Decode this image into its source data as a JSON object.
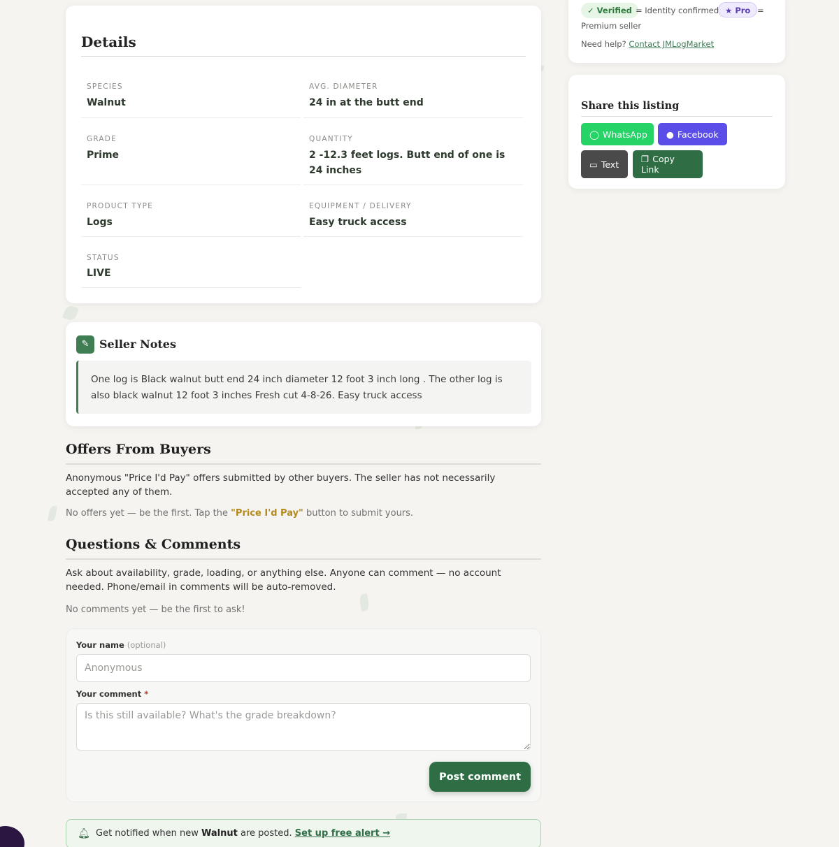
{
  "details": {
    "title": "Details",
    "fields": [
      {
        "label": "SPECIES",
        "value": "Walnut"
      },
      {
        "label": "AVG. DIAMETER",
        "value": "24 in at the butt end"
      },
      {
        "label": "GRADE",
        "value": "Prime"
      },
      {
        "label": "QUANTITY",
        "value": "2 -12.3 feet logs. Butt end of one is 24 inches"
      },
      {
        "label": "PRODUCT TYPE",
        "value": "Logs"
      },
      {
        "label": "EQUIPMENT / DELIVERY",
        "value": "Easy truck access"
      },
      {
        "label": "STATUS",
        "value": "LIVE"
      }
    ]
  },
  "seller_notes": {
    "title": "Seller Notes",
    "text": "One log is Black walnut  butt end 24 inch diameter 12 foot 3 inch long . The other log is also black walnut 12 foot 3 inches Fresh cut 4-8-26. Easy truck access"
  },
  "offers": {
    "title": "Offers From Buyers",
    "description": "Anonymous \"Price I'd Pay\" offers submitted by other buyers. The seller has not necessarily accepted any of them.",
    "empty_prefix": "No offers yet — be the first. Tap the ",
    "empty_highlight": "\"Price I'd Pay\"",
    "empty_suffix": " button to submit yours."
  },
  "comments": {
    "title": "Questions & Comments",
    "description": "Ask about availability, grade, loading, or anything else. Anyone can comment — no account needed. Phone/email in comments will be auto-removed.",
    "empty": "No comments yet — be the first to ask!",
    "form": {
      "name_label": "Your name",
      "name_optional": "(optional)",
      "name_placeholder": "Anonymous",
      "comment_label": "Your comment",
      "comment_required": "*",
      "comment_placeholder": "Is this still available? What's the grade breakdown?",
      "submit_label": "Post comment"
    }
  },
  "alert": {
    "prefix": "Get notified when new ",
    "species": "Walnut",
    "middle": " are posted. ",
    "link": "Set up free alert →"
  },
  "legend": {
    "verified_badge": "Verified",
    "verified_desc": "= Identity confirmed",
    "pro_badge": "Pro",
    "pro_desc_eq": "=",
    "pro_desc": "Premium seller",
    "help_prefix": "Need help?",
    "help_link": "Contact JMLogMarket"
  },
  "share": {
    "title": "Share this listing",
    "buttons": [
      {
        "label": "WhatsApp",
        "color": "#25d366"
      },
      {
        "label": "Facebook",
        "color": "#5b4ee8"
      },
      {
        "label": "Text",
        "color": "#4a4a4a"
      },
      {
        "label": "Copy Link",
        "color": "#2f6e45"
      }
    ]
  },
  "colors": {
    "accent": "#2f6e45",
    "highlight": "#b48a1e"
  },
  "icons": {
    "notes": "pencil-icon",
    "alert": "bell-icon",
    "whatsapp": "whatsapp-icon",
    "facebook": "facebook-icon",
    "text": "message-icon",
    "copy": "copy-icon",
    "verified": "check-icon",
    "pro": "star-icon"
  }
}
